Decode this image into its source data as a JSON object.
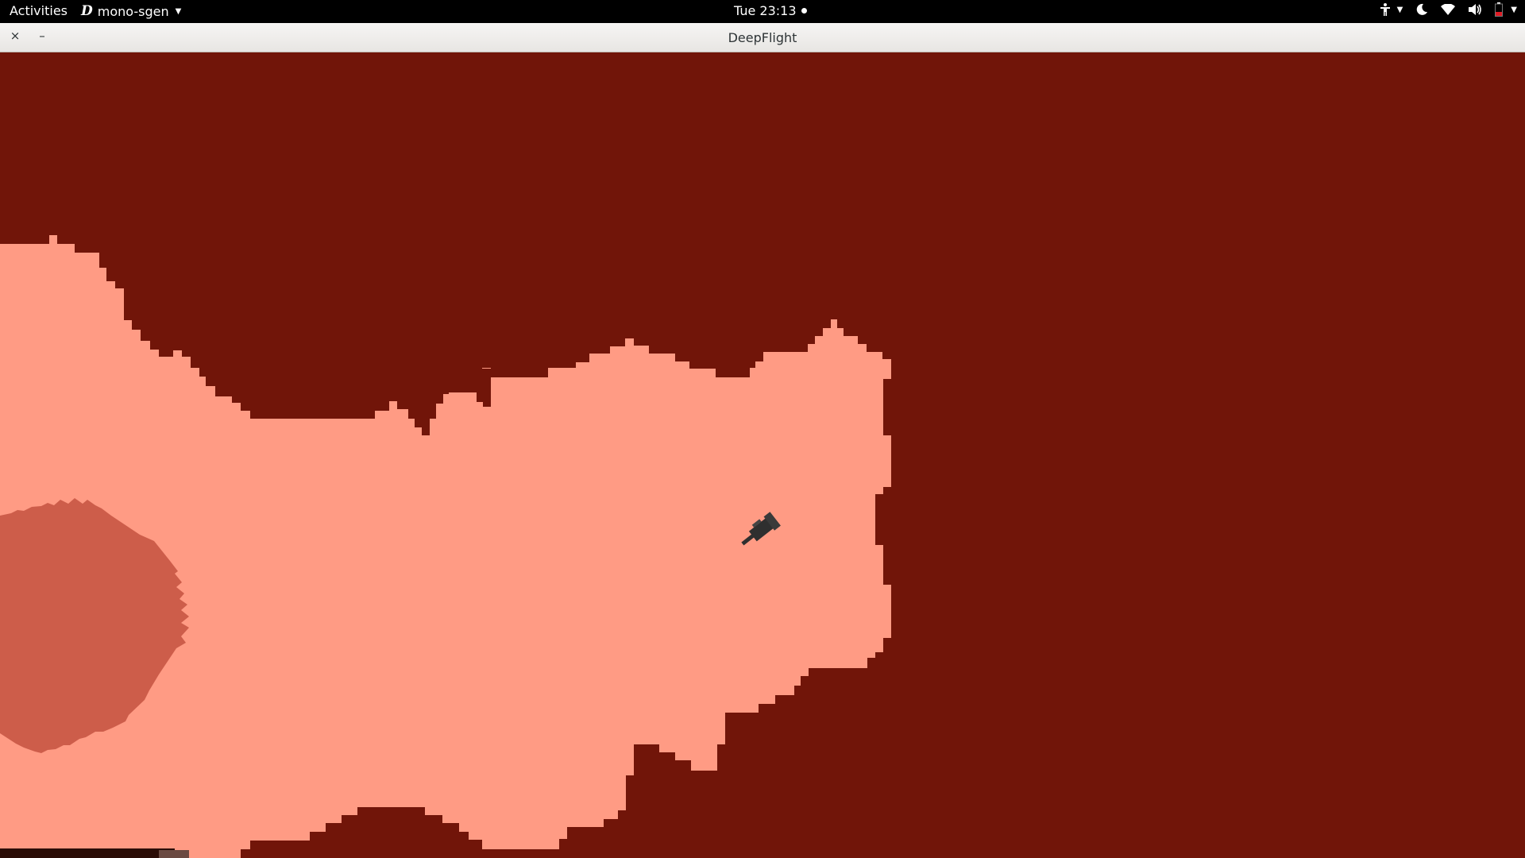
{
  "topbar": {
    "activities_label": "Activities",
    "app_icon_glyph": "D",
    "app_name": "mono-sgen",
    "clock": "Tue 23:13",
    "status_icons": [
      "accessibility-icon",
      "night-light-icon",
      "wifi-icon",
      "volume-icon",
      "battery-icon"
    ]
  },
  "window": {
    "title": "DeepFlight",
    "close_glyph": "×",
    "minimize_glyph": "–"
  },
  "game": {
    "colors": {
      "rock": "#711509",
      "cave": "#ff9b84",
      "blob": "#cd5d4a",
      "ship": "#2f2f2f"
    }
  }
}
